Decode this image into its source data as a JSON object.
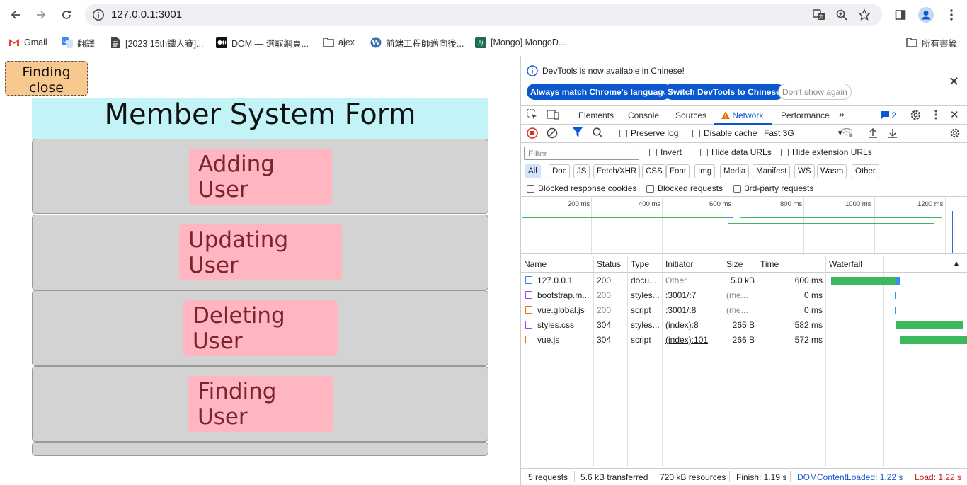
{
  "browser": {
    "url": "127.0.0.1:3001",
    "bookmarks": [
      {
        "label": "Gmail",
        "icon": "gmail-icon"
      },
      {
        "label": "翻譯",
        "icon": "translate-icon"
      },
      {
        "label": "[2023 15th鐵人賽]...",
        "icon": "document-icon"
      },
      {
        "label": "DOM — 選取網頁...",
        "icon": "medium-icon"
      },
      {
        "label": "ajex",
        "icon": "folder-icon"
      },
      {
        "label": "前端工程師邁向後...",
        "icon": "wordpress-icon"
      },
      {
        "label": "[Mongo] MongoD...",
        "icon": "pjcheat-icon"
      }
    ],
    "all_bookmarks": "所有書籤"
  },
  "page": {
    "close_button": "Finding close",
    "form_title": "Member System Form",
    "panels": [
      "Adding User",
      "Updating User",
      "Deleting User",
      "Finding User"
    ]
  },
  "devtools": {
    "banner": {
      "message": "DevTools is now available in Chinese!",
      "btn_match": "Always match Chrome's language",
      "btn_switch": "Switch DevTools to Chinese",
      "btn_dismiss": "Don't show again"
    },
    "tabs": [
      "Elements",
      "Console",
      "Sources",
      "Network",
      "Performance"
    ],
    "issues_count": "2",
    "toolbar": {
      "preserve_log": "Preserve log",
      "disable_cache": "Disable cache",
      "throttle": "Fast 3G"
    },
    "filter": {
      "placeholder": "Filter",
      "invert": "Invert",
      "hide_data_urls": "Hide data URLs",
      "hide_ext_urls": "Hide extension URLs"
    },
    "type_filters": [
      "All",
      "Doc",
      "JS",
      "Fetch/XHR",
      "CSS",
      "Font",
      "Img",
      "Media",
      "Manifest",
      "WS",
      "Wasm",
      "Other"
    ],
    "more_filters": [
      "Blocked response cookies",
      "Blocked requests",
      "3rd-party requests"
    ],
    "overview_ticks": [
      "200 ms",
      "400 ms",
      "600 ms",
      "800 ms",
      "1000 ms",
      "1200 ms"
    ],
    "columns": [
      "Name",
      "Status",
      "Type",
      "Initiator",
      "Size",
      "Time",
      "Waterfall"
    ],
    "requests": [
      {
        "name": "127.0.0.1",
        "status": "200",
        "type": "docu...",
        "initiator": "Other",
        "size": "5.0 kB",
        "time": "600 ms",
        "kind": "doc",
        "color": "#3e7fe0"
      },
      {
        "name": "bootstrap.m...",
        "status": "200",
        "type": "styles...",
        "initiator": ":3001/:7",
        "size": "(me...",
        "time": "0 ms",
        "kind": "css",
        "color": "#a142f4"
      },
      {
        "name": "vue.global.js",
        "status": "200",
        "type": "script",
        "initiator": ":3001/:8",
        "size": "(me...",
        "time": "0 ms",
        "kind": "js",
        "color": "#e8710a"
      },
      {
        "name": "styles.css",
        "status": "304",
        "type": "styles...",
        "initiator": "(index):8",
        "size": "265 B",
        "time": "582 ms",
        "kind": "css",
        "color": "#a142f4"
      },
      {
        "name": "vue.js",
        "status": "304",
        "type": "script",
        "initiator": "(index):101",
        "size": "266 B",
        "time": "572 ms",
        "kind": "js",
        "color": "#e8710a"
      }
    ],
    "status": {
      "requests": "5 requests",
      "transferred": "5.6 kB transferred",
      "resources": "720 kB resources",
      "finish": "Finish: 1.19 s",
      "dcl": "DOMContentLoaded: 1.22 s",
      "load": "Load: 1.22 s"
    }
  }
}
